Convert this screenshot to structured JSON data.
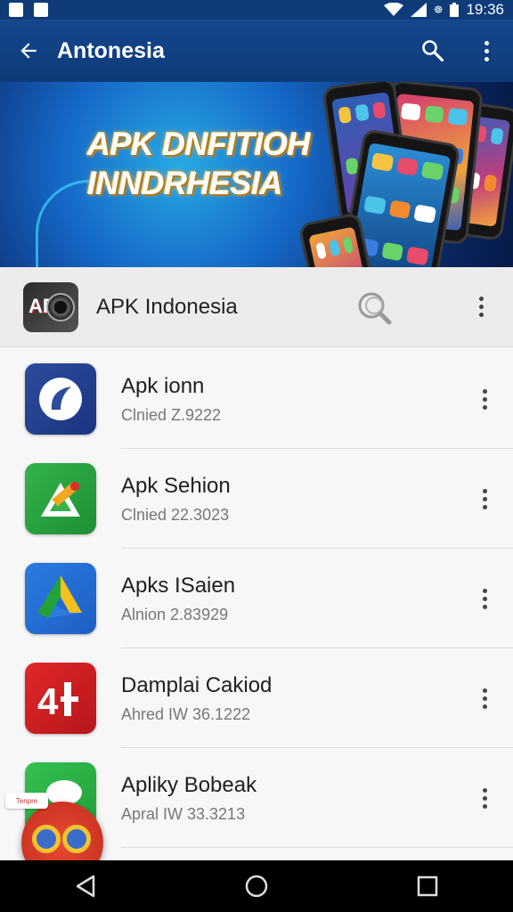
{
  "status_bar": {
    "time": "19:36",
    "signal_glyph": "☸"
  },
  "app_bar": {
    "title": "Antonesia",
    "back_icon": "arrow-back-icon",
    "search_icon": "search-icon",
    "more_icon": "more-vert-icon"
  },
  "banner": {
    "headline_line1": "APK DNFITIOH",
    "headline_line2": "INNDRHESIA"
  },
  "app_header": {
    "name": "APK Indonesia",
    "logo_text": "APK"
  },
  "apps": [
    {
      "title": "Apk ionn",
      "subtitle": "Clnied Z.9222",
      "icon": "blue-refresh-icon"
    },
    {
      "title": "Apk Sehion",
      "subtitle": "Clnied 22.3023",
      "icon": "green-ruler-icon"
    },
    {
      "title": "Apks ISaien",
      "subtitle": "Alnion 2.83929",
      "icon": "drive-triangle-icon"
    },
    {
      "title": "Damplai Cakiod",
      "subtitle": "Ahred IW 36.1222",
      "icon": "red-4-icon"
    },
    {
      "title": "Apliky Bobeak",
      "subtitle": "Apral IW 33.3213",
      "icon": "green-chat-icon"
    }
  ],
  "fab": {
    "chip_text": "Tenpre"
  },
  "colors": {
    "appbar": "#15478d",
    "accent": "#f2b33a"
  }
}
